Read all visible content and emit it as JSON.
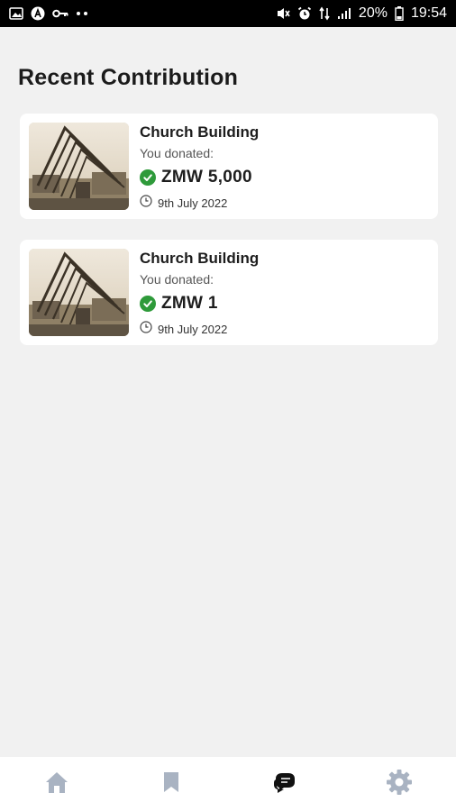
{
  "status_bar": {
    "battery": "20%",
    "time": "19:54",
    "icons": [
      "image-icon",
      "a-icon",
      "key-icon",
      "dots-icon",
      "mute-icon",
      "alarm-icon",
      "data-icon",
      "signal-icon",
      "battery-icon"
    ]
  },
  "page": {
    "title": "Recent Contribution"
  },
  "contributions": [
    {
      "title": "Church Building",
      "label": "You donated:",
      "amount": "ZMW 5,000",
      "date": "9th July 2022"
    },
    {
      "title": "Church Building",
      "label": "You donated:",
      "amount": "ZMW 1",
      "date": "9th July 2022"
    }
  ],
  "bottom_nav": {
    "items": [
      "home-icon",
      "bookmark-icon",
      "chat-icon",
      "settings-icon"
    ],
    "active_color": "#111111",
    "inactive_color": "#a9b3c2"
  },
  "colors": {
    "check": "#2e9a3a",
    "background": "#f1f1f1"
  }
}
